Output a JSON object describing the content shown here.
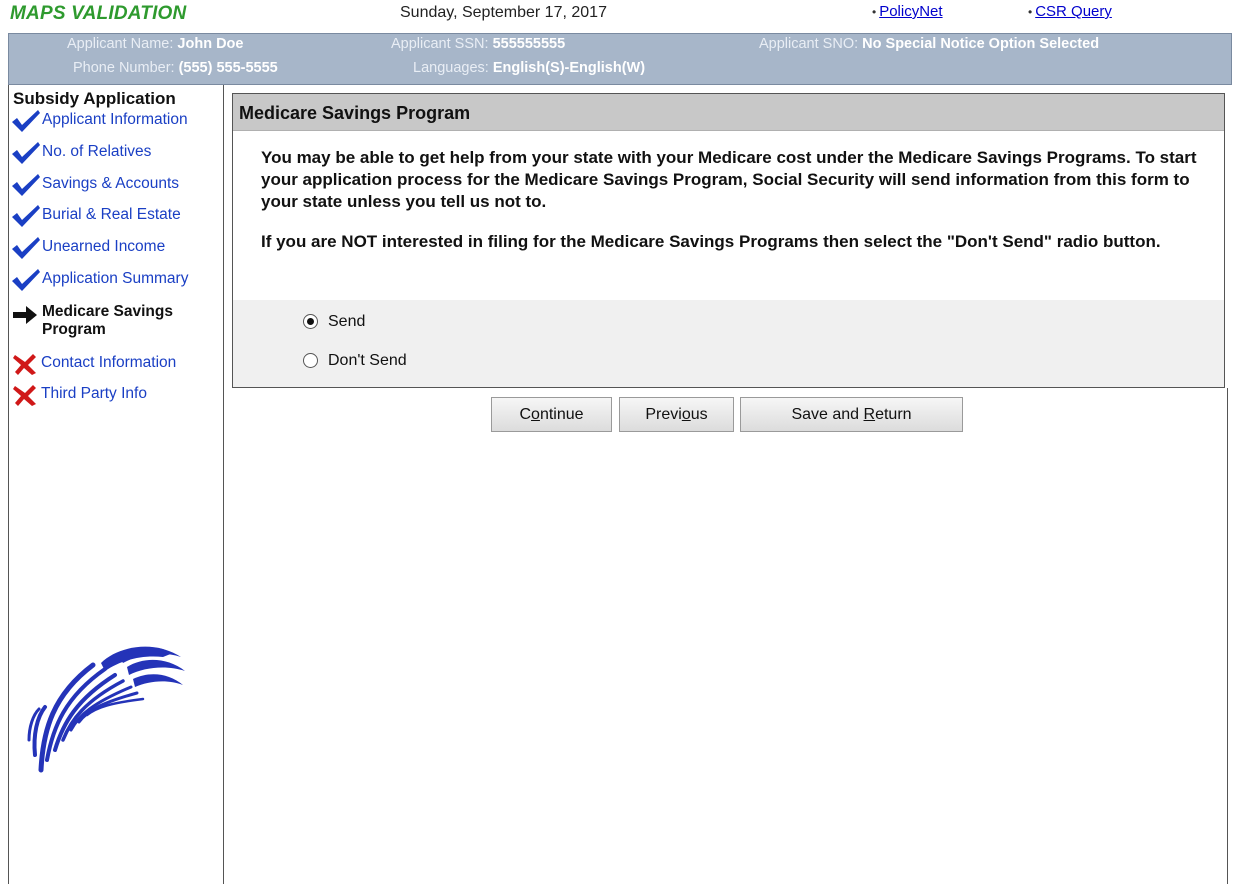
{
  "header": {
    "app_title": "MAPS VALIDATION",
    "date": "Sunday, September 17, 2017",
    "links": [
      {
        "bullet": "•",
        "label": "PolicyNet"
      },
      {
        "bullet": "•",
        "label": "CSR Query"
      }
    ]
  },
  "applicant": {
    "name_label": "Applicant Name:",
    "name": "John Doe",
    "ssn_label": "Applicant SSN:",
    "ssn": "555555555",
    "sno_label": "Applicant SNO:",
    "sno": "No Special Notice Option Selected",
    "phone_label": "Phone Number:",
    "phone": "(555) 555-5555",
    "languages_label": "Languages:",
    "languages": "English(S)-English(W)"
  },
  "sidebar": {
    "title": "Subsidy Application",
    "items": [
      {
        "label": "Applicant Information",
        "status": "complete",
        "icon": "checkmark-icon"
      },
      {
        "label": "No. of Relatives",
        "status": "complete",
        "icon": "checkmark-icon"
      },
      {
        "label": "Savings & Accounts",
        "status": "complete",
        "icon": "checkmark-icon"
      },
      {
        "label": "Burial & Real Estate",
        "status": "complete",
        "icon": "checkmark-icon"
      },
      {
        "label": "Unearned Income",
        "status": "complete",
        "icon": "checkmark-icon"
      },
      {
        "label": "Application Summary",
        "status": "complete",
        "icon": "checkmark-icon"
      },
      {
        "label": "Medicare Savings Program",
        "status": "current",
        "icon": "arrow-right-icon"
      },
      {
        "label": "Contact Information",
        "status": "incomplete",
        "icon": "x-icon"
      },
      {
        "label": "Third Party Info",
        "status": "incomplete",
        "icon": "x-icon"
      }
    ]
  },
  "main": {
    "section_title": "Medicare Savings Program",
    "paragraphs": [
      "You may be able to get help from your state with your Medicare cost under the Medicare Savings Programs. To start your application process for the Medicare Savings Program, Social Security will send information from this form to your state unless you tell us not to.",
      "If you are NOT interested in filing for the Medicare Savings Programs then select the \"Don't Send\" radio button."
    ],
    "options": [
      {
        "label": "Send",
        "selected": true
      },
      {
        "label": "Don't Send",
        "selected": false
      }
    ]
  },
  "buttons": {
    "continue": {
      "label": "Continue",
      "before": "C",
      "accel": "o",
      "after": "ntinue"
    },
    "previous": {
      "label": "Previous",
      "before": "Previ",
      "accel": "o",
      "after": "us"
    },
    "save_return": {
      "label": "Save and Return",
      "before": "Save and ",
      "accel": "R",
      "after": "eturn"
    }
  },
  "colors": {
    "title_green": "#2e9a2e",
    "info_bar": "#a7b6c9",
    "link_blue": "#1a3fc4",
    "check_blue": "#1a3fc4",
    "x_red": "#d01818",
    "emblem_blue": "#2433b8"
  }
}
